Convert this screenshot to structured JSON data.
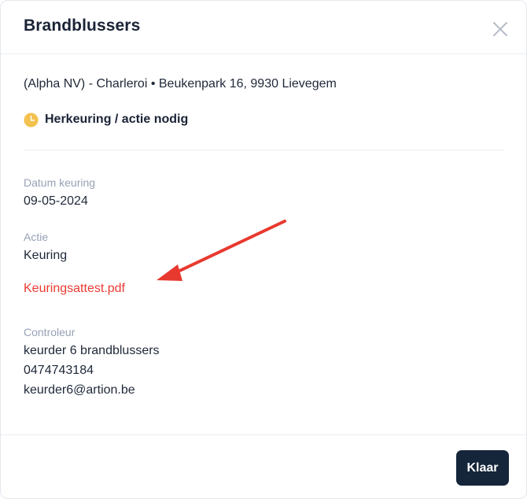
{
  "modal": {
    "title": "Brandblussers",
    "close_icon": "close-icon"
  },
  "location": {
    "address": "(Alpha NV) - Charleroi • Beukenpark 16, 9930 Lievegem"
  },
  "status": {
    "icon": "clock-icon",
    "icon_color": "#f2c14e",
    "text": "Herkeuring / actie nodig"
  },
  "details": {
    "date_label": "Datum keuring",
    "date_value": "09-05-2024",
    "action_label": "Actie",
    "action_value": "Keuring",
    "attachment_link": "Keuringsattest.pdf",
    "attachment_color": "#ea3b32"
  },
  "controller": {
    "label": "Controleur",
    "name": "keurder 6 brandblussers",
    "phone": "0474743184",
    "email": "keurder6@artion.be"
  },
  "annotation": {
    "arrow_icon": "red-arrow-icon",
    "arrow_color": "#e8392f"
  },
  "footer": {
    "done_label": "Klaar",
    "button_color": "#15253a"
  }
}
